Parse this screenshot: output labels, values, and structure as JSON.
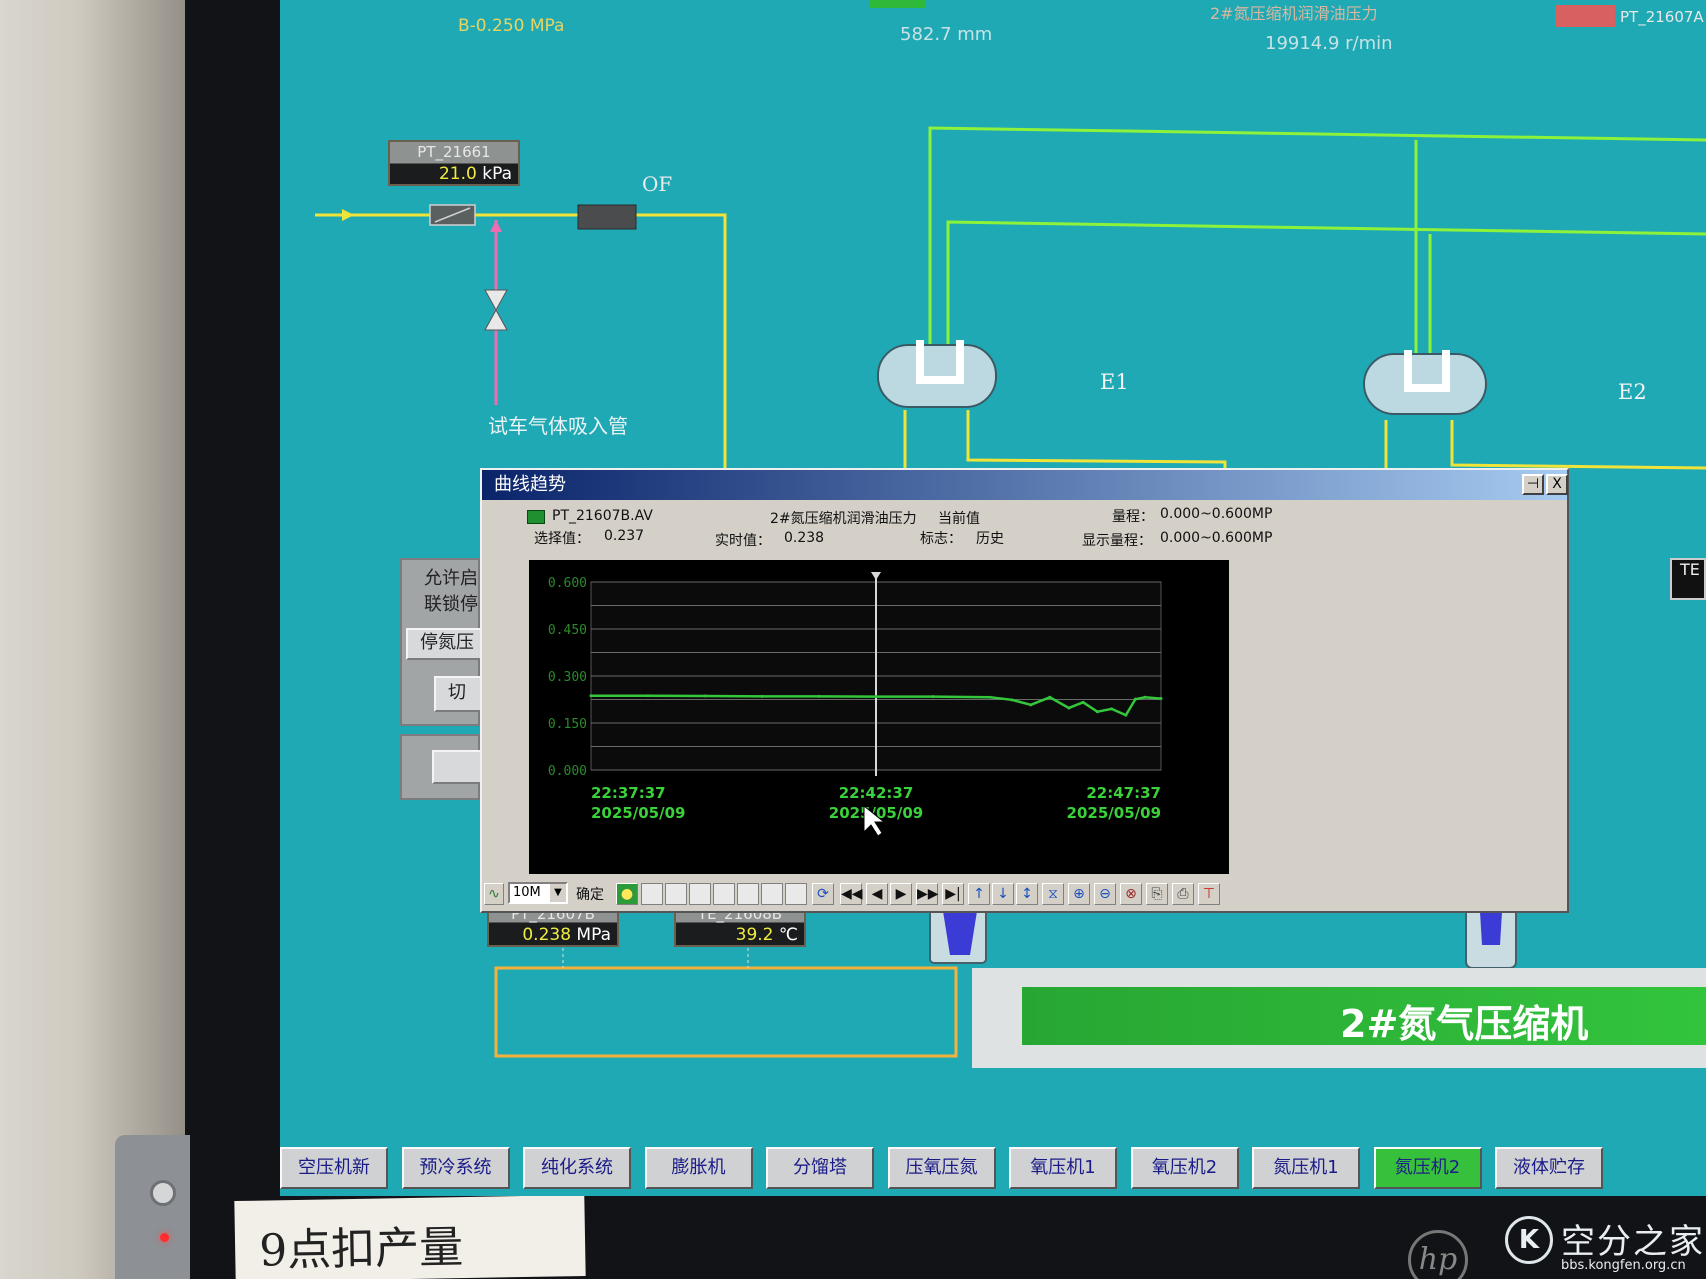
{
  "header": {
    "pressure_readout": "B-0.250 MPa",
    "level_readout": "582.7 mm",
    "speed_readout": "19914.9 r/min",
    "title_fragment": "2#氮压缩机润滑油压力",
    "right_tag": "PT_21607A"
  },
  "tags": {
    "pt_21661": {
      "name": "PT_21661",
      "value": "21.0",
      "unit": "kPa"
    },
    "pt_21607b": {
      "name": "PT_21607B",
      "value": "0.238",
      "unit": "MPa"
    },
    "te_21608b": {
      "name": "TE_21608B",
      "value": "39.2",
      "unit": "℃"
    }
  },
  "labels": {
    "intake_pipe": "试车气体吸入管",
    "of": "OF",
    "e1": "E1",
    "e2": "E2",
    "right_edge_tag": "TE"
  },
  "interlock_panel": {
    "line1": "允许启",
    "line2": "联锁停",
    "stop_button": "停氮压",
    "switch_button": "切"
  },
  "trend_dialog": {
    "title": "曲线趋势",
    "pin_icon": "⊣",
    "close_label": "X",
    "series_tag": "PT_21607B.AV",
    "series_desc": "2#氮压缩机润滑油压力",
    "mode_label": "当前值",
    "range_label": "量程：",
    "range_value": "0.000~0.600MP",
    "selected_label": "选择值：",
    "selected_value": "0.237",
    "realtime_label": "实时值：",
    "realtime_value": "0.238",
    "flag_label": "标志：",
    "flag_value": "历史",
    "display_range_label": "显示量程：",
    "display_range_value": "0.000~0.600MP",
    "interval_value": "10M",
    "confirm_label": "确定"
  },
  "chart_data": {
    "type": "line",
    "series": [
      {
        "name": "PT_21607B.AV",
        "x": [
          "22:37:37",
          "22:38:37",
          "22:39:37",
          "22:40:37",
          "22:41:37",
          "22:42:37",
          "22:43:37",
          "22:44:37",
          "22:45:00",
          "22:45:20",
          "22:45:40",
          "22:46:00",
          "22:46:15",
          "22:46:30",
          "22:46:45",
          "22:47:00",
          "22:47:10",
          "22:47:20",
          "22:47:37"
        ],
        "values": [
          0.237,
          0.237,
          0.236,
          0.235,
          0.235,
          0.234,
          0.234,
          0.232,
          0.224,
          0.208,
          0.232,
          0.198,
          0.216,
          0.186,
          0.195,
          0.175,
          0.226,
          0.232,
          0.228
        ],
        "color": "#34c63b"
      }
    ],
    "x_tick_labels": [
      {
        "time": "22:37:37",
        "date": "2025/05/09"
      },
      {
        "time": "22:42:37",
        "date": "2025/05/09"
      },
      {
        "time": "22:47:37",
        "date": "2025/05/09"
      }
    ],
    "y_tick_labels": [
      "0.600",
      "0.450",
      "0.300",
      "0.150",
      "0.000"
    ],
    "ylim": [
      0,
      0.6
    ],
    "cursor_time": "22:42:37",
    "grid": true,
    "background": "#000000"
  },
  "banner": {
    "title": "2#氮气压缩机"
  },
  "tabs": [
    {
      "label": "空压机新"
    },
    {
      "label": "预冷系统"
    },
    {
      "label": "纯化系统"
    },
    {
      "label": "膨胀机"
    },
    {
      "label": "分馏塔"
    },
    {
      "label": "压氧压氮"
    },
    {
      "label": "氧压机1"
    },
    {
      "label": "氧压机2"
    },
    {
      "label": "氮压机1"
    },
    {
      "label": "氮压机2",
      "active": true
    },
    {
      "label": "液体贮存"
    }
  ],
  "sticky_note": {
    "text": "9点扣产量"
  },
  "watermark": {
    "name": "空分之家",
    "url": "bbs.kongfen.org.cn"
  },
  "monitor_brand": "hp",
  "colors": {
    "screen_bg": "#1fa9b5",
    "pipe_yellow": "#f0e438",
    "pipe_green": "#8df23a",
    "pipe_pink": "#f06bb0",
    "trend_line": "#34c63b",
    "active_tab": "#36c03c"
  }
}
